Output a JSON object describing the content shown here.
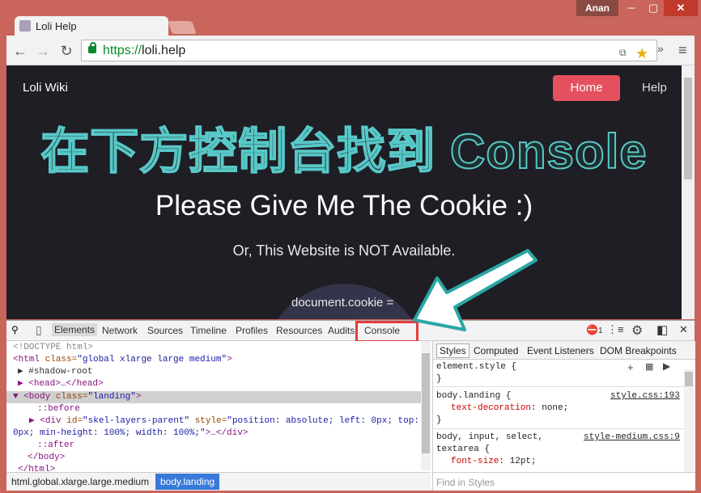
{
  "window": {
    "tab_title": "Loli Help",
    "user_badge": "Anan",
    "min_label": "─",
    "max_label": "▢",
    "close_label": "✕"
  },
  "toolbar": {
    "url_scheme": "https://",
    "url_host": "loli.help",
    "back_icon": "←",
    "forward_icon": "→",
    "reload_icon": "↻",
    "star_icon": "★",
    "translate_icon": "⧉",
    "more_icon": "»",
    "menu_icon": "≡"
  },
  "page": {
    "brand": "Loli Wiki",
    "home_button": "Home",
    "help_link": "Help",
    "overlay_title": "在下方控制台找到 Console",
    "headline": "Please Give Me The Cookie :)",
    "subline": "Or, This Website is NOT Available.",
    "cookie_snippet": "document.cookie ="
  },
  "devtools": {
    "tabs": [
      "Elements",
      "Network",
      "Sources",
      "Timeline",
      "Profiles",
      "Resources",
      "Audits",
      "Console"
    ],
    "error_count": "1",
    "search_icon": "🔍",
    "device_icon": "▯",
    "settings_icon": "⚙",
    "dock_icon": "◧",
    "close_icon": "✕",
    "drawer_icon": "⋮≡",
    "dom_lines": {
      "l1": "<!DOCTYPE html>",
      "l2_tag": "<html",
      "l2_attr": " class=",
      "l2_val": "\"global xlarge large medium\"",
      "l2_end": ">",
      "l3": "▶ #shadow-root",
      "l4": "▶ <head>…</head>",
      "l5_tag": "▼ <body",
      "l5_attr": " class=",
      "l5_val": "\"landing\"",
      "l5_end": ">",
      "l6": "::before",
      "l7_tag": "▶ <div",
      "l7_attr1": " id=",
      "l7_val1": "\"skel-layers-parent\"",
      "l7_attr2": " style=",
      "l7_val2": "\"position: absolute; left: 0px; top:",
      "l8_val": "0px; min-height: 100%; width: 100%;\"",
      "l8_end": ">…</div>",
      "l9": "::after",
      "l10": "</body>",
      "l11": "</html>"
    },
    "breadcrumbs": [
      "html.global.xlarge.large.medium",
      "body.landing"
    ],
    "styles_tabs": [
      "Styles",
      "Computed",
      "Event Listeners",
      "DOM Breakpoints"
    ],
    "styles": {
      "r1_selector": "element.style {",
      "r1_close": "}",
      "r2_selector": "body.landing {",
      "r2_src": "style.css:193",
      "r2_prop": "text-decoration",
      "r2_value": ": none;",
      "r2_close": "}",
      "r3_selector": "body, input, select,",
      "r3_selector2": "textarea {",
      "r3_src": "style-medium.css:9",
      "r3_prop": "font-size",
      "r3_value": ": 12pt;",
      "find_placeholder": "Find in Styles"
    }
  },
  "colors": {
    "accent_home": "#e5505f",
    "overlay_stroke": "#58c8c8",
    "console_highlight": "#e43b3b"
  }
}
